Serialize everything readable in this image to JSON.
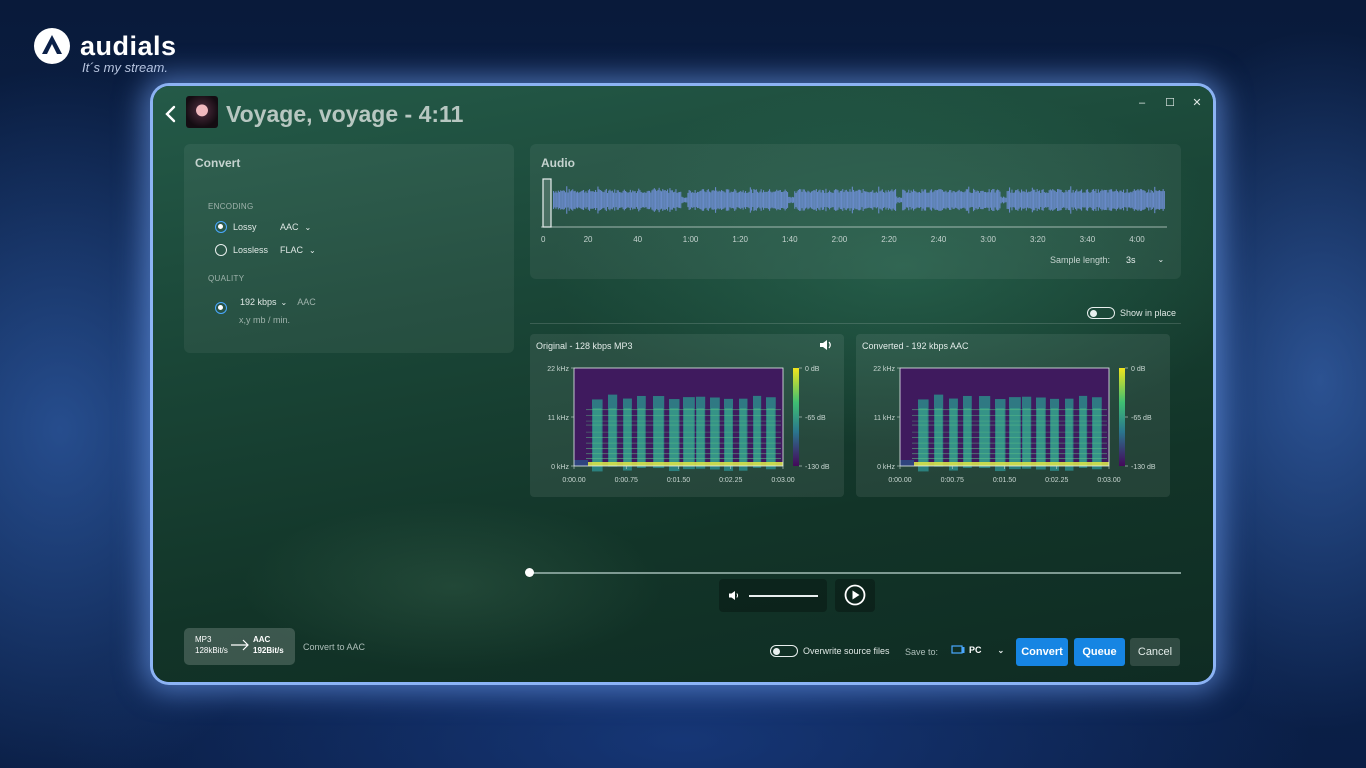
{
  "brand": {
    "name": "audials",
    "tagline": "It´s my stream."
  },
  "window": {
    "title": "Voyage, voyage - 4:11",
    "minimize": "–",
    "maximize": "☐",
    "close": "✕"
  },
  "convert": {
    "title": "Convert",
    "encoding_label": "ENCODING",
    "lossy_label": "Lossy",
    "lossy_format": "AAC",
    "lossless_label": "Lossless",
    "lossless_format": "FLAC",
    "quality_label": "QUALITY",
    "bitrate": "192 kbps",
    "bitrate_codec": "AAC",
    "size_estimate": "x,y mb / min."
  },
  "audio": {
    "title": "Audio",
    "timeline": [
      "0",
      "20",
      "40",
      "1:00",
      "1:20",
      "1:40",
      "2:00",
      "2:20",
      "2:40",
      "3:00",
      "3:20",
      "3:40",
      "4:00"
    ],
    "sample_length_label": "Sample length:",
    "sample_length_value": "3s",
    "show_in_place": "Show in place"
  },
  "spectrogram_original": {
    "title": "Original - 128 kbps MP3",
    "y_ticks": [
      "22 kHz",
      "11 kHz",
      "0 kHz"
    ],
    "x_ticks": [
      "0:00.00",
      "0:00.75",
      "0:01.50",
      "0:02.25",
      "0:03.00"
    ],
    "db_ticks": [
      "0 dB",
      "-65 dB",
      "-130 dB"
    ]
  },
  "spectrogram_converted": {
    "title": "Converted - 192 kbps AAC",
    "y_ticks": [
      "22 kHz",
      "11 kHz",
      "0 kHz"
    ],
    "x_ticks": [
      "0:00.00",
      "0:00.75",
      "0:01.50",
      "0:02.25",
      "0:03.00"
    ],
    "db_ticks": [
      "0 dB",
      "-65 dB",
      "-130 dB"
    ]
  },
  "footer": {
    "src_format": "MP3",
    "src_bitrate": "128kBit/s",
    "dst_format": "AAC",
    "dst_bitrate": "192Bit/s",
    "convert_to": "Convert to AAC",
    "overwrite": "Overwrite source files",
    "save_to_label": "Save to:",
    "save_to_value": "PC",
    "convert_btn": "Convert",
    "queue_btn": "Queue",
    "cancel_btn": "Cancel"
  },
  "colors": {
    "accent": "#1685e3",
    "wave": "#6f8fd6"
  }
}
